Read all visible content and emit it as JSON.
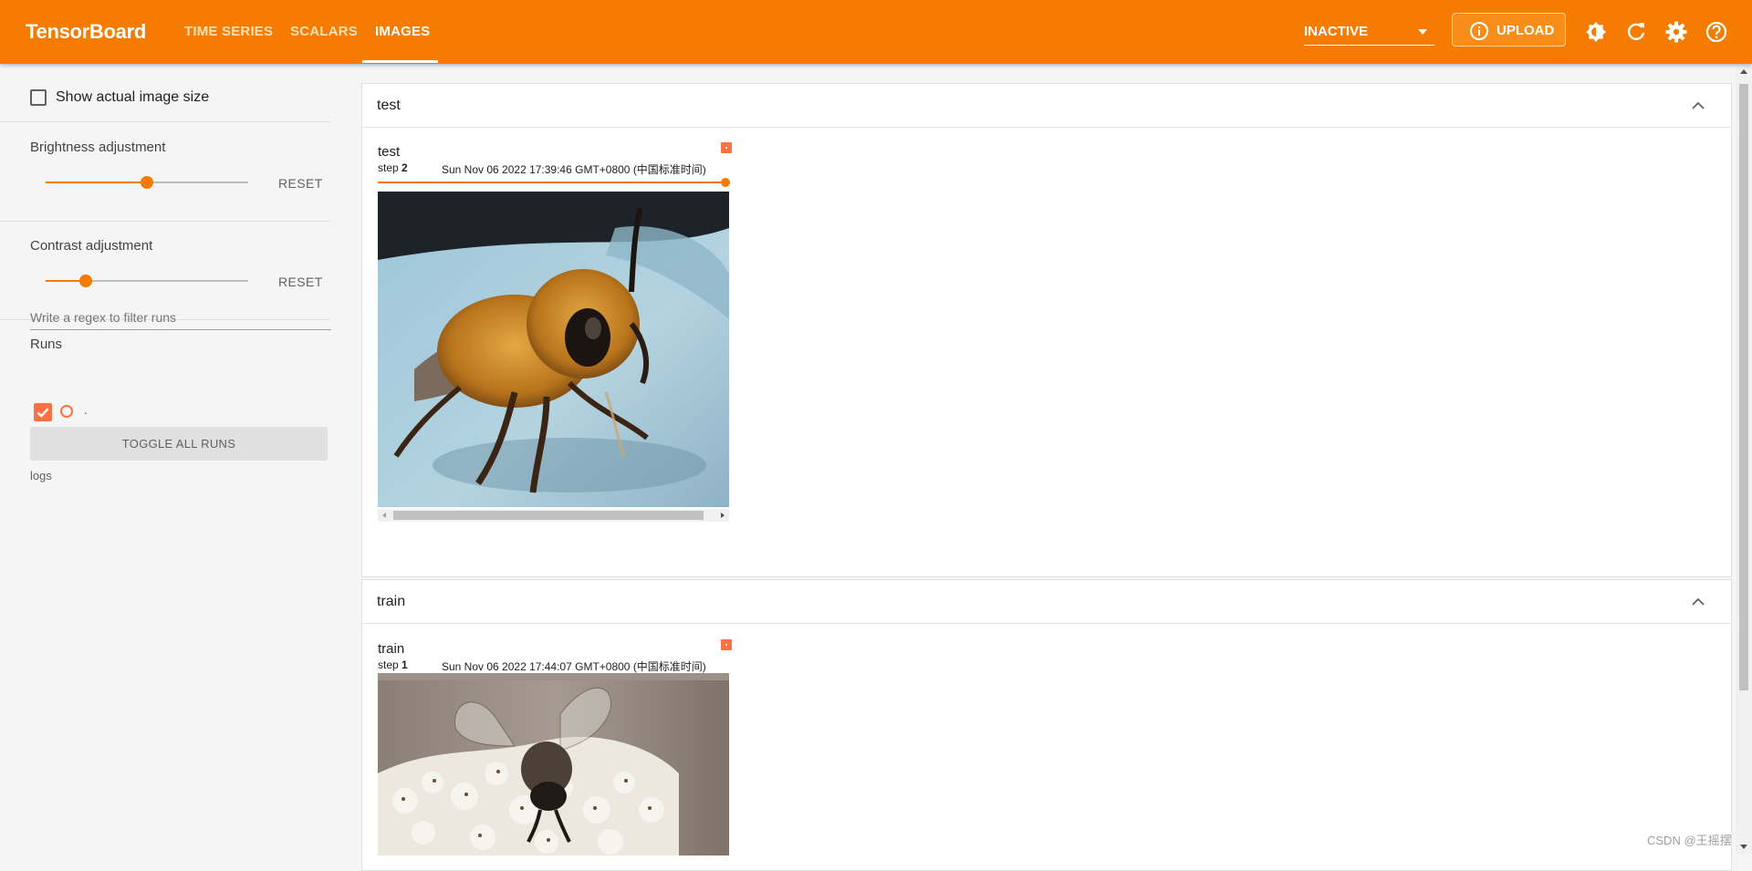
{
  "app": {
    "title": "TensorBoard"
  },
  "nav": {
    "tabs": [
      {
        "label": "TIME SERIES",
        "active": false
      },
      {
        "label": "SCALARS",
        "active": false
      },
      {
        "label": "IMAGES",
        "active": true
      }
    ]
  },
  "toolbar": {
    "status_select": "INACTIVE",
    "upload_label": "UPLOAD",
    "icons": [
      "upload-info-icon",
      "theme-brightness-icon",
      "refresh-icon",
      "settings-gear-icon",
      "help-icon"
    ],
    "accent_color": "#f57c00"
  },
  "sidebar": {
    "show_actual_size_label": "Show actual image size",
    "show_actual_size_checked": false,
    "brightness": {
      "title": "Brightness adjustment",
      "value": 0.5,
      "reset_label": "RESET"
    },
    "contrast": {
      "title": "Contrast adjustment",
      "value": 0.2,
      "reset_label": "RESET"
    },
    "runs": {
      "title": "Runs",
      "filter_placeholder": "Write a regex to filter runs",
      "items": [
        {
          "name": ".",
          "checked": true,
          "color": "#ff7043"
        }
      ],
      "toggle_all_label": "TOGGLE ALL RUNS",
      "logdir_label": "logs"
    }
  },
  "main": {
    "groups": [
      {
        "name": "test",
        "card": {
          "tag": "test",
          "step_label": "step",
          "step": "2",
          "time": "Sun Nov 06 2022 17:39:46 GMT+0800 (中国标准时间)",
          "step_slider_value": 1.0,
          "image_desc": "honeybee on blue surface"
        }
      },
      {
        "name": "train",
        "card": {
          "tag": "train",
          "step_label": "step",
          "step": "1",
          "time": "Sun Nov 06 2022 17:44:07 GMT+0800 (中国标准时间)",
          "image_desc": "bee on white flowers"
        }
      }
    ]
  },
  "watermark": "CSDN @王摇摆"
}
